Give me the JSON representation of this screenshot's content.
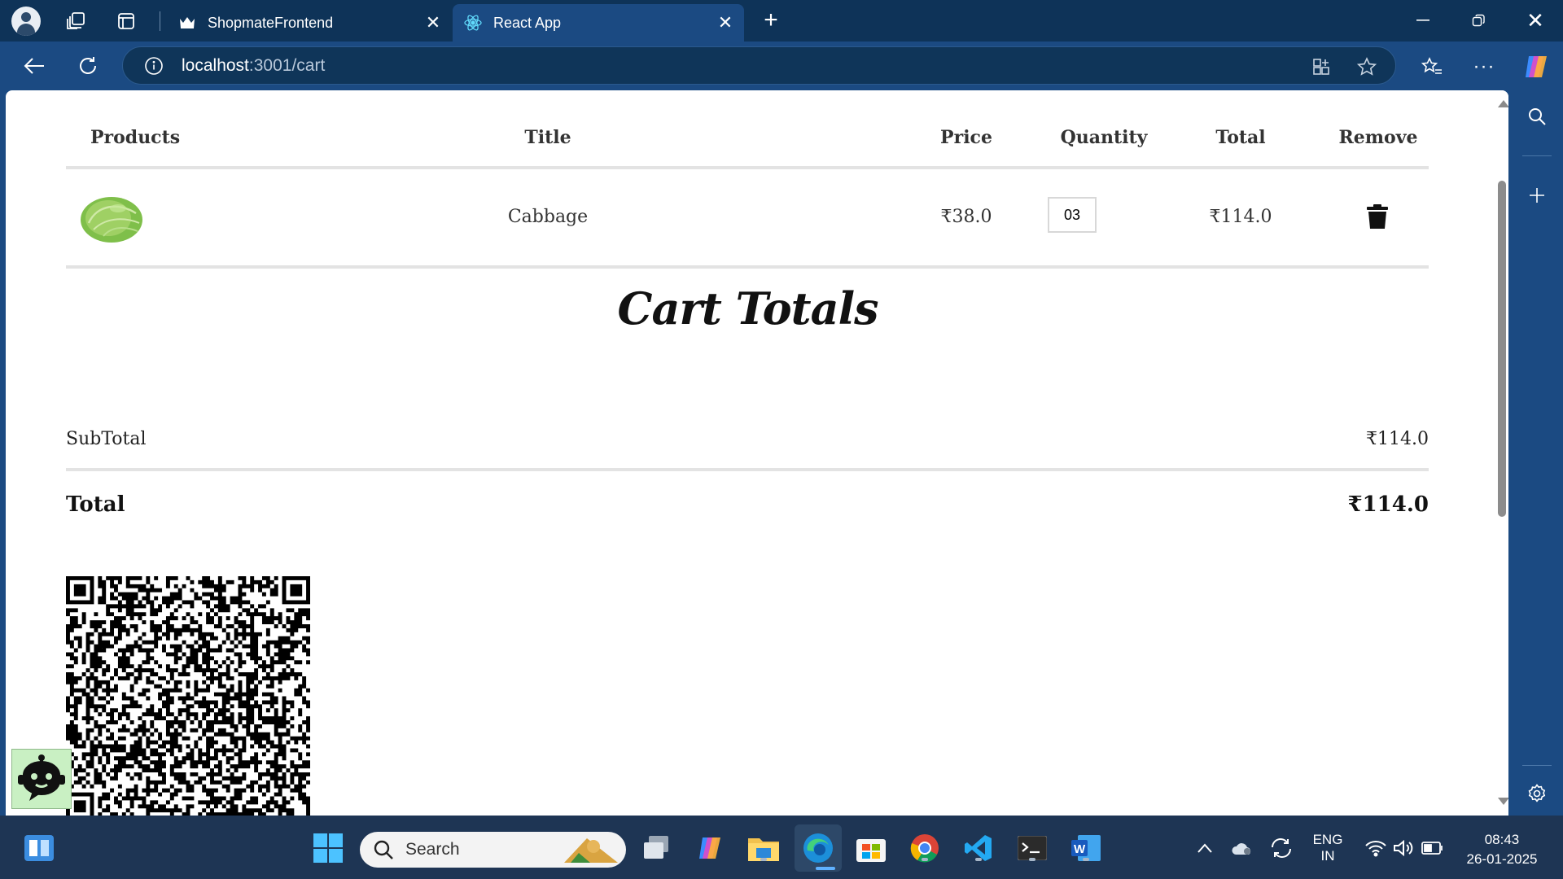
{
  "browser": {
    "tabs": [
      {
        "title": "ShopmateFrontend",
        "active": false
      },
      {
        "title": "React App",
        "active": true
      }
    ],
    "url_host": "localhost",
    "url_path": ":3001/cart"
  },
  "cart": {
    "headers": {
      "products": "Products",
      "title": "Title",
      "price": "Price",
      "quantity": "Quantity",
      "total": "Total",
      "remove": "Remove"
    },
    "items": [
      {
        "title": "Cabbage",
        "price": "₹38.0",
        "quantity": "03",
        "total": "₹114.0",
        "image_icon": "cabbage"
      }
    ]
  },
  "totals": {
    "heading": "Cart Totals",
    "subtotal_label": "SubTotal",
    "subtotal_value": "₹114.0",
    "total_label": "Total",
    "total_value": "₹114.0"
  },
  "taskbar": {
    "search_placeholder": "Search",
    "lang_line1": "ENG",
    "lang_line2": "IN",
    "time": "08:43",
    "date": "26-01-2025"
  },
  "colors": {
    "tabbar": "#0e3358",
    "toolbar": "#1b4a82",
    "taskbar": "#1e3554",
    "divider": "#e3e3e3"
  }
}
